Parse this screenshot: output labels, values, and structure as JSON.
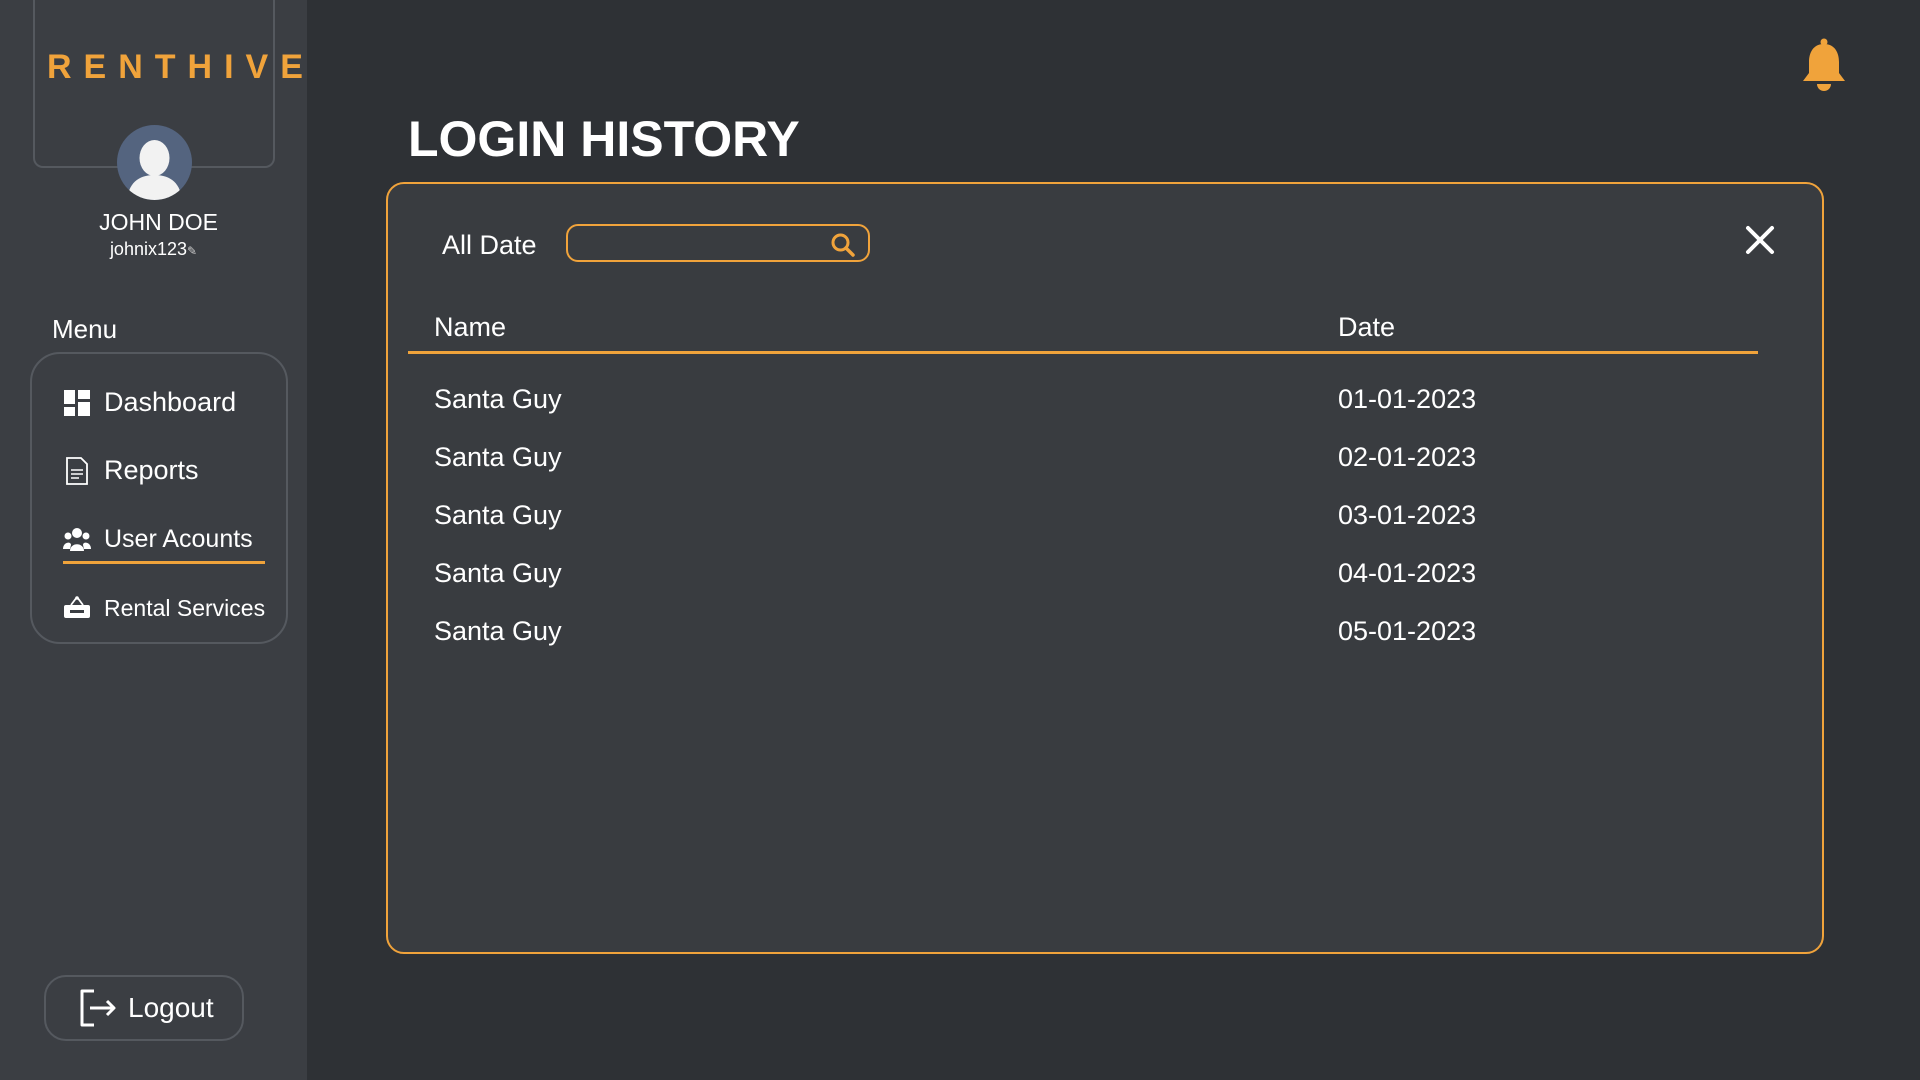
{
  "brand": {
    "logo_text": "RENTHIVE",
    "accent": "#f0a33b"
  },
  "user": {
    "name": "JOHN DOE",
    "handle": "johnix123"
  },
  "sidebar": {
    "menu_label": "Menu",
    "items": [
      {
        "label": "Dashboard",
        "icon": "dashboard-icon"
      },
      {
        "label": "Reports",
        "icon": "report-icon"
      },
      {
        "label": "User Acounts",
        "icon": "users-icon",
        "active": true
      },
      {
        "label": "Rental Services",
        "icon": "rent-sign-icon"
      }
    ],
    "logout_label": "Logout"
  },
  "header": {
    "notification_icon": "bell-icon"
  },
  "main": {
    "title": "LOGIN HISTORY",
    "filter": {
      "label": "All Date",
      "value": "",
      "placeholder": ""
    },
    "table": {
      "columns": [
        "Name",
        "Date"
      ],
      "rows": [
        {
          "name": "Santa Guy",
          "date": "01-01-2023"
        },
        {
          "name": "Santa Guy",
          "date": "02-01-2023"
        },
        {
          "name": "Santa Guy",
          "date": "03-01-2023"
        },
        {
          "name": "Santa Guy",
          "date": "04-01-2023"
        },
        {
          "name": "Santa Guy",
          "date": "05-01-2023"
        }
      ]
    }
  }
}
